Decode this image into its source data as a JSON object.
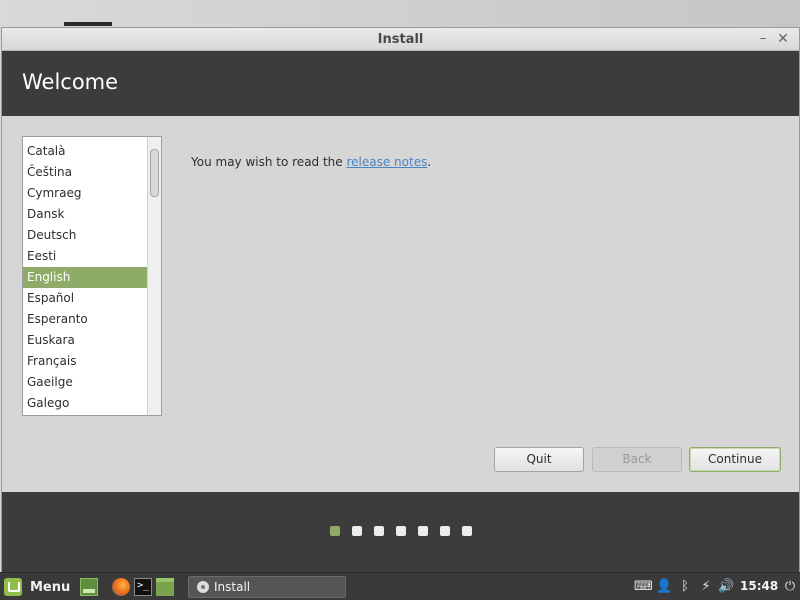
{
  "window": {
    "title": "Install",
    "minimize_glyph": "–",
    "close_glyph": "✕"
  },
  "header": {
    "title": "Welcome"
  },
  "languages": [
    {
      "label": "Català",
      "selected": false
    },
    {
      "label": "Čeština",
      "selected": false
    },
    {
      "label": "Cymraeg",
      "selected": false
    },
    {
      "label": "Dansk",
      "selected": false
    },
    {
      "label": "Deutsch",
      "selected": false
    },
    {
      "label": "Eesti",
      "selected": false
    },
    {
      "label": "English",
      "selected": true
    },
    {
      "label": "Español",
      "selected": false
    },
    {
      "label": "Esperanto",
      "selected": false
    },
    {
      "label": "Euskara",
      "selected": false
    },
    {
      "label": "Français",
      "selected": false
    },
    {
      "label": "Gaeilge",
      "selected": false
    },
    {
      "label": "Galego",
      "selected": false
    }
  ],
  "release": {
    "prefix": "You may wish to read the ",
    "link": "release notes",
    "suffix": "."
  },
  "buttons": {
    "quit": "Quit",
    "back": "Back",
    "continue": "Continue"
  },
  "progress": {
    "total_steps": 7,
    "current_step": 1
  },
  "colors": {
    "accent": "#8fab68",
    "header_band": "#3c3c3c",
    "link": "#4a86c5"
  },
  "taskbar": {
    "menu_label": "Menu",
    "task_label": "Install",
    "clock": "15:48",
    "icons": [
      "mint-logo-icon",
      "show-desktop-icon",
      "firefox-icon",
      "terminal-icon",
      "files-icon",
      "keyboard-icon",
      "user-icon",
      "bluetooth-icon",
      "network-icon",
      "volume-icon",
      "power-icon"
    ],
    "terminal_glyph": ">_"
  }
}
